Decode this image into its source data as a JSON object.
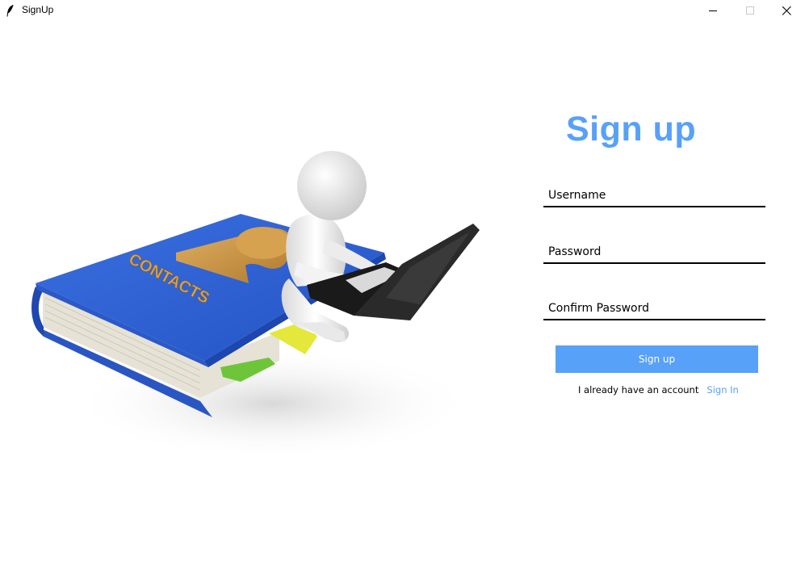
{
  "window": {
    "title": "SignUp",
    "app_icon": "feather-icon",
    "controls": [
      "minimize-icon",
      "maximize-icon",
      "close-icon"
    ]
  },
  "illustration": {
    "book_cover_text": "CONTACTS"
  },
  "form": {
    "heading": "Sign up",
    "username_placeholder": "Username",
    "password_placeholder": "Password",
    "confirm_password_placeholder": "Confirm Password",
    "submit_label": "Sign up",
    "account_prompt": "I already have an account",
    "signin_link": "Sign In"
  },
  "colors": {
    "accent": "#57a1f8",
    "book_blue": "#2f5fd0",
    "text": "#000000"
  }
}
